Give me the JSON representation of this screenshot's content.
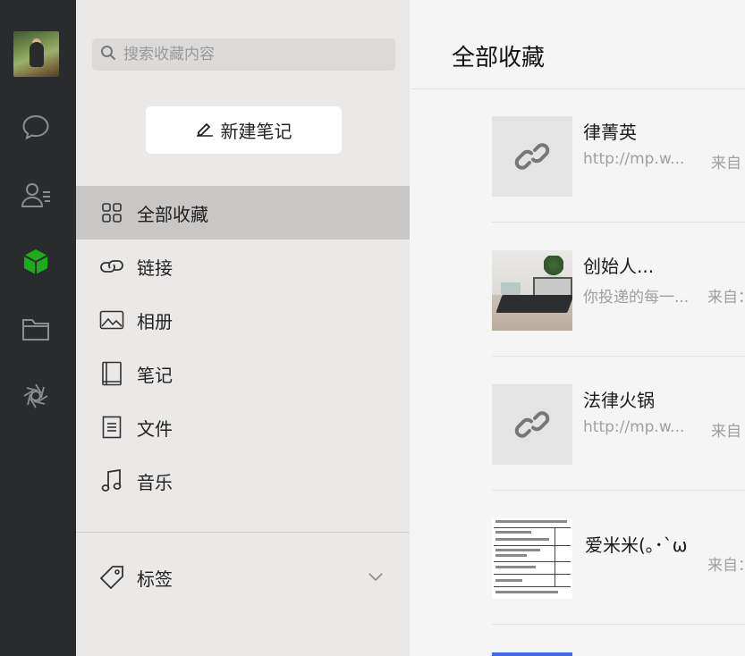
{
  "search": {
    "placeholder": "搜索收藏内容"
  },
  "new_note": {
    "label": "新建笔记"
  },
  "sidebar": {
    "items": [
      {
        "label": "全部收藏",
        "icon": "grid-icon",
        "active": true
      },
      {
        "label": "链接",
        "icon": "link-icon"
      },
      {
        "label": "相册",
        "icon": "image-icon"
      },
      {
        "label": "笔记",
        "icon": "notebook-icon"
      },
      {
        "label": "文件",
        "icon": "file-icon"
      },
      {
        "label": "音乐",
        "icon": "music-icon"
      }
    ],
    "tags": {
      "label": "标签",
      "icon": "tag-icon"
    }
  },
  "rail": {
    "icons": [
      "avatar",
      "chat-icon",
      "contacts-icon",
      "favorites-cube-icon",
      "folder-icon",
      "moments-icon"
    ],
    "active_color": "#1aad19"
  },
  "main": {
    "title": "全部收藏",
    "cards": [
      {
        "title": "律菁英",
        "subtitle": "http://mp.w...",
        "from": "来自",
        "thumb": "link-icon"
      },
      {
        "title": "创始人...",
        "subtitle": "你投递的每一...",
        "from": "来自：",
        "thumb": "photo"
      },
      {
        "title": "法律火锅",
        "subtitle": "http://mp.w...",
        "from": "来自",
        "thumb": "link-icon"
      },
      {
        "title": "爱米米(｡･`ω",
        "subtitle": "",
        "from": "来自：",
        "thumb": "document"
      }
    ]
  }
}
